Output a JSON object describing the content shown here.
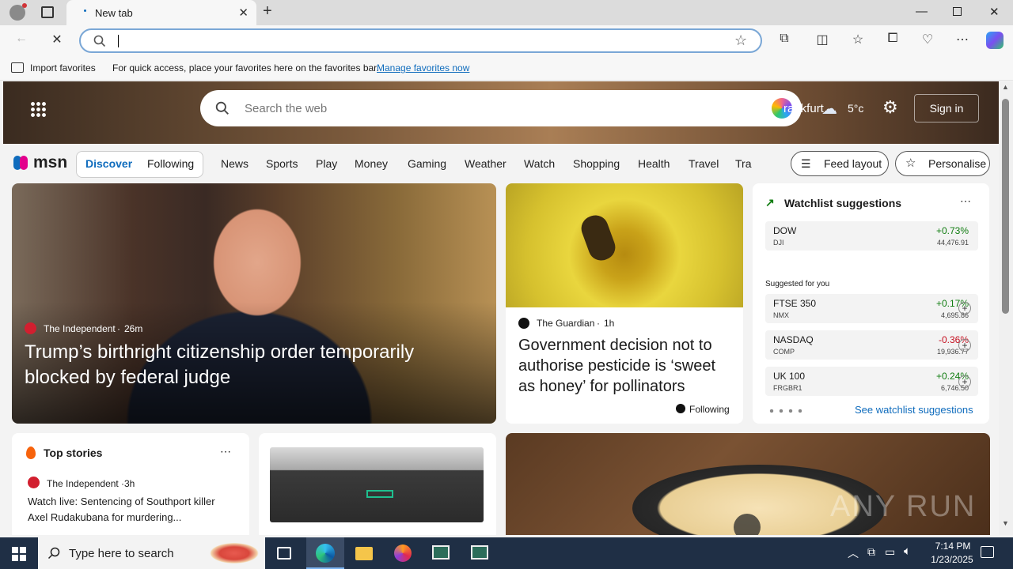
{
  "browser": {
    "tab_title": "New tab",
    "address_value": "",
    "favbar_import": "Import favorites",
    "favbar_text": "For quick access, place your favorites here on the favorites bar.",
    "favbar_link": "Manage favorites now"
  },
  "msn": {
    "search_placeholder": "Search the web",
    "weather_city": "rankfurt",
    "weather_temp": "5°c",
    "sign_in": "Sign in",
    "logo": "msn",
    "tabs": [
      "Discover",
      "Following"
    ],
    "nav": [
      "News",
      "Sports",
      "Play",
      "Money",
      "Gaming",
      "Weather",
      "Watch",
      "Shopping",
      "Health",
      "Travel",
      "Tra"
    ],
    "feed_layout": "Feed layout",
    "personalise": "Personalise"
  },
  "hero_story": {
    "source": "The Independent",
    "age": "26m",
    "headline": "Trump’s birthright citizenship order temporarily blocked by federal judge"
  },
  "story2": {
    "source": "The Guardian",
    "age": "1h",
    "headline": "Government decision not to authorise pesticide is ‘sweet as honey’ for pollinators",
    "following": "Following"
  },
  "watchlist": {
    "title": "Watchlist suggestions",
    "dow": {
      "name": "DOW",
      "sub": "DJI",
      "pct": "+0.73%",
      "val": "44,476.91"
    },
    "suggested_label": "Suggested for you",
    "items": [
      {
        "name": "FTSE 350",
        "sub": "NMX",
        "pct": "+0.17%",
        "val": "4,695.86"
      },
      {
        "name": "NASDAQ",
        "sub": "COMP",
        "pct": "-0.36%",
        "val": "19,936.77"
      },
      {
        "name": "UK 100",
        "sub": "FRGBR1",
        "pct": "+0.24%",
        "val": "6,746.50"
      }
    ],
    "see_link": "See watchlist suggestions"
  },
  "top_stories": {
    "title": "Top stories",
    "source": "The Independent",
    "age": "3h",
    "headline": "Watch live: Sentencing of Southport killer Axel Rudakubana for murdering..."
  },
  "taskbar": {
    "search_placeholder": "Type here to search",
    "time": "7:14 PM",
    "date": "1/23/2025"
  },
  "watermark": "ANY RUN",
  "colors": {
    "accent": "#0f6cbd",
    "positive": "#107c10",
    "negative": "#c50f1f",
    "taskbar": "#1f2f45"
  }
}
